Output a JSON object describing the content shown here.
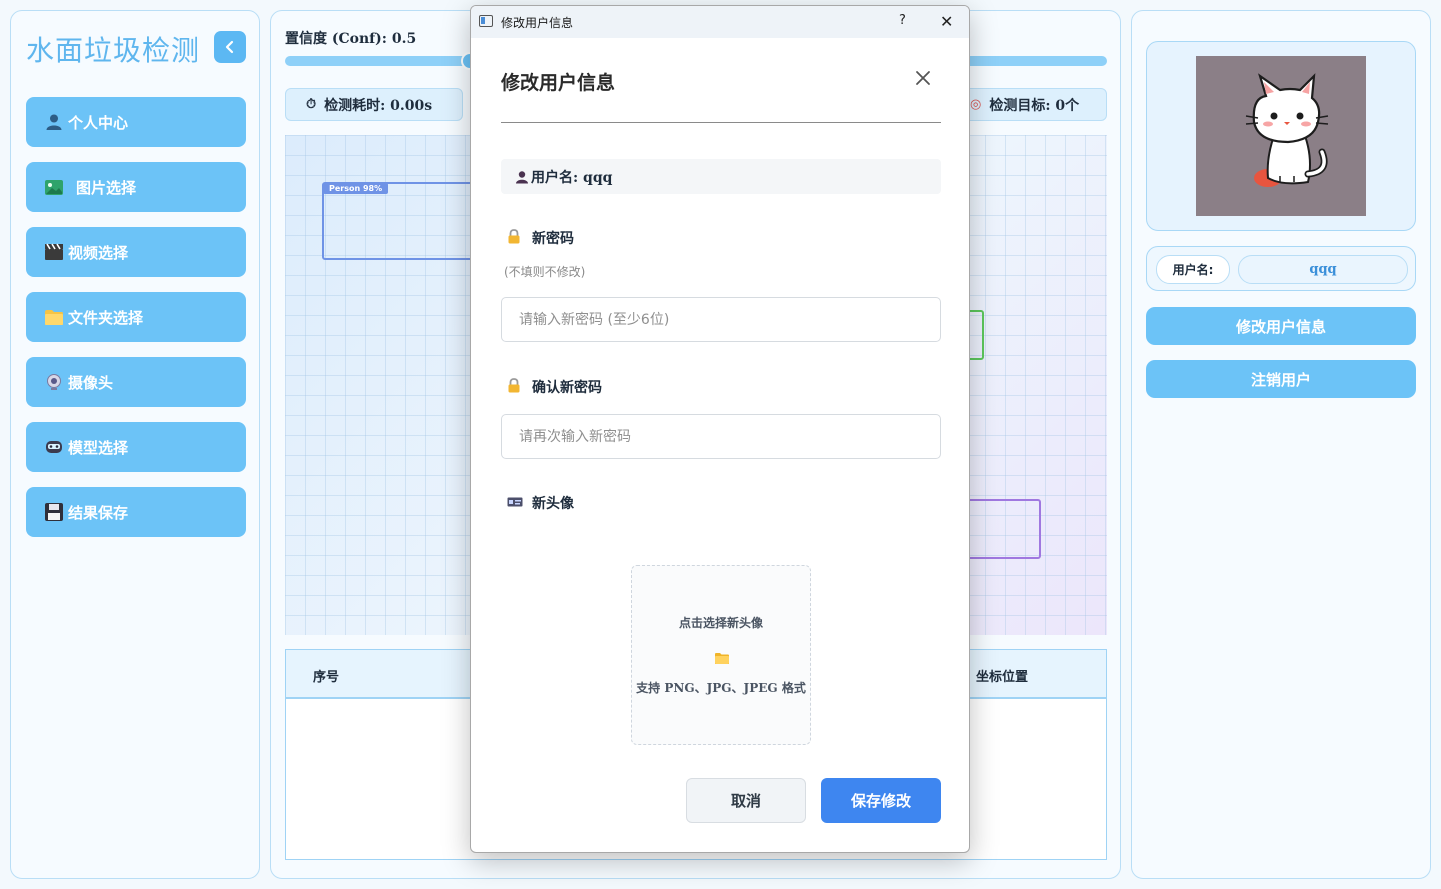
{
  "app": {
    "title": "水面垃圾检测"
  },
  "sidebar": {
    "items": [
      {
        "label": "个人中心",
        "icon": "user-icon"
      },
      {
        "label": "图片选择",
        "icon": "image-icon"
      },
      {
        "label": "视频选择",
        "icon": "clapperboard-icon"
      },
      {
        "label": "文件夹选择",
        "icon": "folder-icon"
      },
      {
        "label": "摄像头",
        "icon": "webcam-icon"
      },
      {
        "label": "模型选择",
        "icon": "robot-icon"
      },
      {
        "label": "结果保存",
        "icon": "floppy-disk-icon"
      }
    ]
  },
  "main": {
    "conf_label": "置信度 (Conf): 0.5",
    "conf_value": 0.5,
    "stats": {
      "time_label": "检测耗时: 0.00s",
      "target_label": "检测目标: 0个"
    },
    "detection": {
      "tag": "Person 98%"
    },
    "table": {
      "col_index": "序号",
      "col_position": "坐标位置"
    }
  },
  "right": {
    "username_key": "用户名:",
    "username_value": "qqq",
    "edit_button": "修改用户信息",
    "logout_button": "注销用户"
  },
  "dialog": {
    "window_title": "修改用户信息",
    "help": "?",
    "heading": "修改用户信息",
    "username_line": "用户名: qqq",
    "new_password_label": "新密码",
    "new_password_hint": "(不填则不修改)",
    "new_password_placeholder": "请输入新密码 (至少6位)",
    "confirm_password_label": "确认新密码",
    "confirm_password_placeholder": "请再次输入新密码",
    "avatar_label": "新头像",
    "upload_title": "点击选择新头像",
    "upload_formats": "支持 PNG、JPG、JPEG 格式",
    "cancel": "取消",
    "save": "保存修改"
  },
  "colors": {
    "accent": "#6cc3f7",
    "primary_button": "#3e86f0",
    "panel_border": "#b9def6"
  }
}
